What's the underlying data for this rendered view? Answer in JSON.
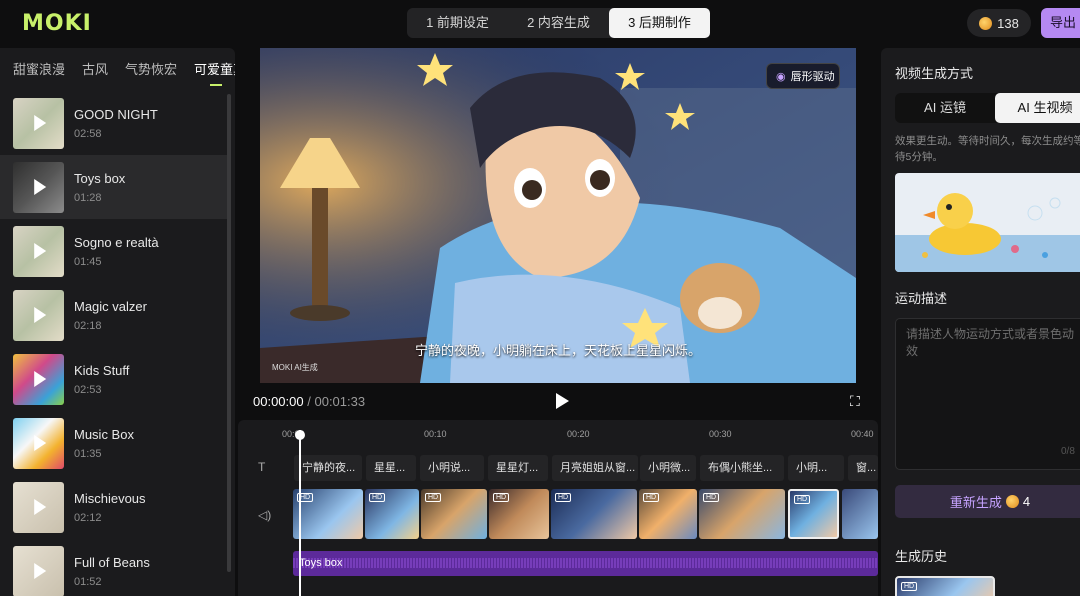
{
  "brand": {
    "logo": "MOKI"
  },
  "steps": [
    {
      "label": "1 前期设定"
    },
    {
      "label": "2 内容生成"
    },
    {
      "label": "3 后期制作"
    }
  ],
  "credits": {
    "value": "138"
  },
  "export": {
    "label": "导出"
  },
  "music": {
    "categories": [
      "甜蜜浪漫",
      "古风",
      "气势恢宏",
      "可爱童真"
    ],
    "tracks": [
      {
        "name": "GOOD NIGHT",
        "duration": "02:58"
      },
      {
        "name": "Toys box",
        "duration": "01:28"
      },
      {
        "name": "Sogno e realtà",
        "duration": "01:45"
      },
      {
        "name": "Magic valzer",
        "duration": "02:18"
      },
      {
        "name": "Kids Stuff",
        "duration": "02:53"
      },
      {
        "name": "Music Box",
        "duration": "01:35"
      },
      {
        "name": "Mischievous",
        "duration": "02:12"
      },
      {
        "name": "Full of Beans",
        "duration": "01:52"
      }
    ]
  },
  "player": {
    "lip_sync_label": "唇形驱动",
    "subtitle": "宁静的夜晚，小明躺在床上，天花板上星星闪烁。",
    "watermark": "MOKI AI生成",
    "current_time": "00:00:00",
    "separator": "/",
    "total_time": "00:01:33"
  },
  "timeline": {
    "ticks": [
      "00:00",
      "00:10",
      "00:20",
      "00:30",
      "00:40"
    ],
    "subtitles": [
      "宁静的夜...",
      "星星...",
      "小明说...",
      "星星灯...",
      "月亮姐姐从窗...",
      "小明微...",
      "布偶小熊坐...",
      "小明...",
      "窗..."
    ],
    "clip_badge": "HD",
    "audio_label": "Toys box"
  },
  "right_panel": {
    "mode_title": "视频生成方式",
    "modes": [
      "AI 运镜",
      "AI 生视频"
    ],
    "hint": "效果更生动。等待时间久，每次生成约等待5分钟。",
    "motion_title": "运动描述",
    "motion_placeholder": "请描述人物运动方式或者景色动效",
    "counter": "0/8",
    "regen_label": "重新生成",
    "regen_cost": "4",
    "history_title": "生成历史",
    "history_badge": "HD"
  }
}
